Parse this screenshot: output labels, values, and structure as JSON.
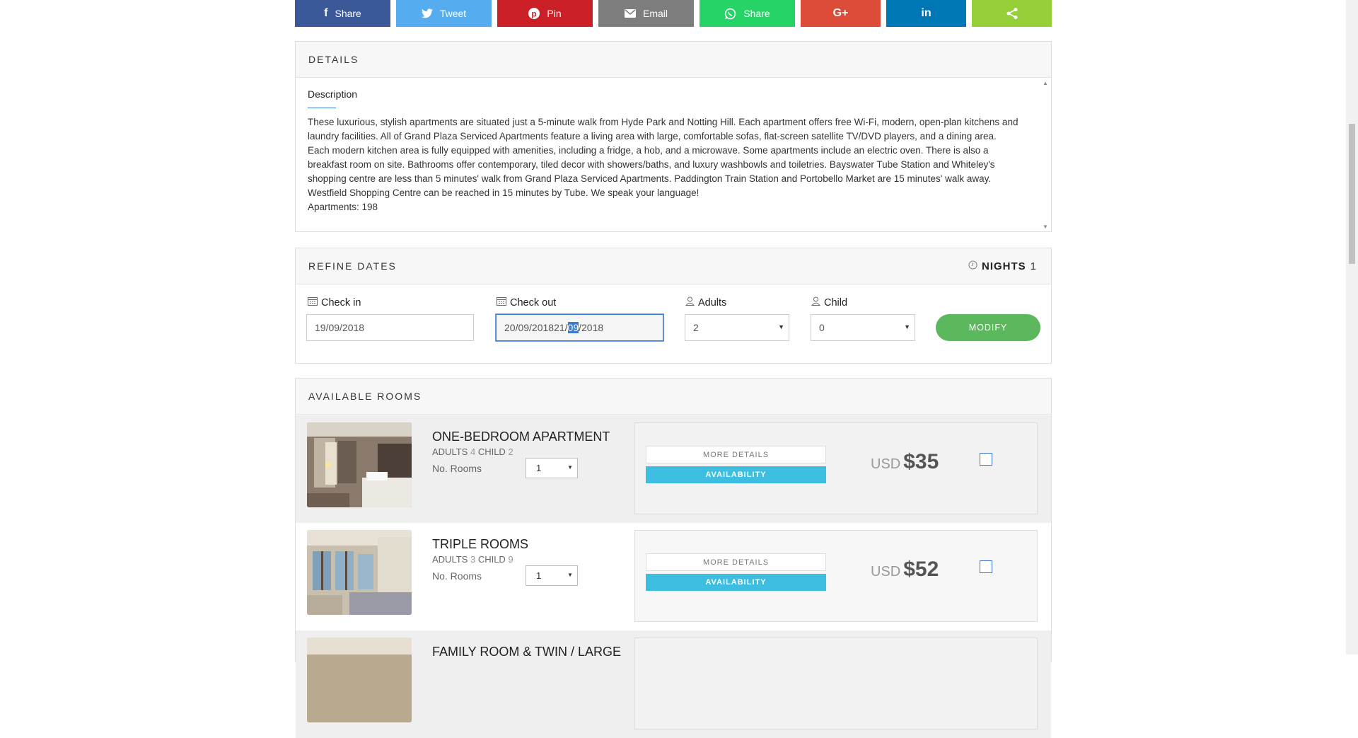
{
  "share": {
    "buttons": [
      {
        "label": "Share",
        "icon": "facebook-icon",
        "color": "#3b5998"
      },
      {
        "label": "Tweet",
        "icon": "twitter-icon",
        "color": "#55acee"
      },
      {
        "label": "Pin",
        "icon": "pinterest-icon",
        "color": "#cb2027"
      },
      {
        "label": "Email",
        "icon": "email-icon",
        "color": "#7d7d7d"
      },
      {
        "label": "Share",
        "icon": "whatsapp-icon",
        "color": "#25d366"
      },
      {
        "label": "",
        "icon": "google-plus-icon",
        "color": "#dd4b39"
      },
      {
        "label": "",
        "icon": "linkedin-icon",
        "color": "#0077b5"
      },
      {
        "label": "",
        "icon": "share-icon",
        "color": "#95d03a"
      }
    ]
  },
  "details": {
    "title": "DETAILS",
    "description_title": "Description",
    "description": "These luxurious, stylish apartments are situated just a 5-minute walk from Hyde Park and Notting Hill. Each apartment offers free Wi-Fi, modern, open-plan kitchens and laundry facilities. All of Grand Plaza Serviced Apartments feature a living area with large, comfortable sofas, flat-screen satellite TV/DVD players, and a dining area. Each modern kitchen area is fully equipped with amenities, including a fridge, a hob, and a microwave. Some apartments include an electric oven. There is also a breakfast room on site. Bathrooms offer contemporary, tiled decor with showers/baths, and luxury washbowls and toiletries. Bayswater Tube Station and Whiteley's shopping centre are less than 5 minutes' walk from Grand Plaza Serviced Apartments. Paddington Train Station and Portobello Market are 15 minutes' walk away. Westfield Shopping Centre can be reached in 15 minutes by Tube. We speak your language!",
    "apartments": "Apartments: 198"
  },
  "refine": {
    "title": "REFINE DATES",
    "nights_label": "NIGHTS",
    "nights_value": "1",
    "checkin_label": "Check in",
    "checkin_value": "19/09/2018",
    "checkout_label": "Check out",
    "checkout_before": "20/09/201821/",
    "checkout_selected": "09",
    "checkout_after": "/2018",
    "adults_label": "Adults",
    "adults_value": "2",
    "child_label": "Child",
    "child_value": "0",
    "modify_label": "MODIFY"
  },
  "rooms": {
    "title": "AVAILABLE ROOMS",
    "adults_word": "ADULTS",
    "child_word": "CHILD",
    "no_rooms_label": "No. Rooms",
    "more_details_label": "MORE DETAILS",
    "availability_label": "AVAILABILITY",
    "currency": "USD",
    "list": [
      {
        "name": "ONE-BEDROOM APARTMENT",
        "adults": "4",
        "child": "2",
        "rooms": "1",
        "price": "$35"
      },
      {
        "name": "TRIPLE ROOMS",
        "adults": "3",
        "child": "9",
        "rooms": "1",
        "price": "$52"
      },
      {
        "name": "FAMILY ROOM & TWIN / LARGE",
        "adults": "",
        "child": "",
        "rooms": "",
        "price": ""
      }
    ]
  }
}
